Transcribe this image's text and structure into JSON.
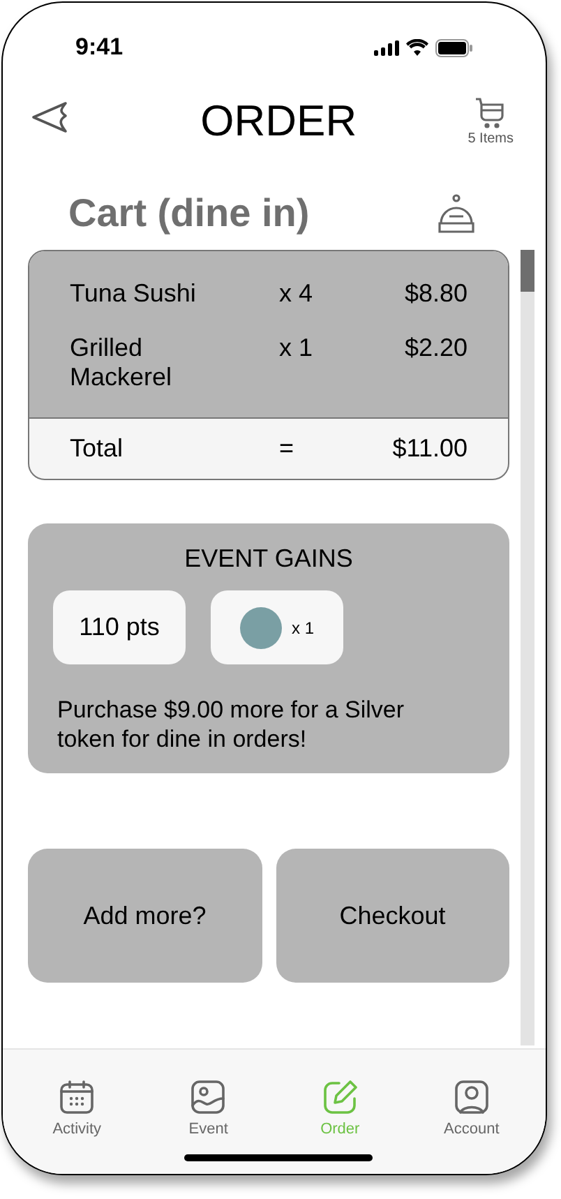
{
  "status_bar": {
    "time": "9:41"
  },
  "header": {
    "title": "ORDER",
    "cart_count": "5 Items"
  },
  "cart": {
    "title": "Cart (dine in)",
    "items": [
      {
        "name": "Tuna Sushi",
        "qty": "x 4",
        "price": "$8.80"
      },
      {
        "name": "Grilled Mackerel",
        "qty": "x 1",
        "price": "$2.20"
      }
    ],
    "total": {
      "label": "Total",
      "sign": "=",
      "amount": "$11.00"
    }
  },
  "event_gains": {
    "title": "EVENT GAINS",
    "points": "110 pts",
    "token": {
      "color": "#7a9fa4",
      "count": "x 1"
    },
    "message": "Purchase $9.00 more for a Silver token for dine in orders!"
  },
  "buttons": [
    "Add more?",
    "Checkout"
  ],
  "tabs": [
    {
      "label": "Activity",
      "selected": false
    },
    {
      "label": "Event",
      "selected": false
    },
    {
      "label": "Order",
      "selected": true
    },
    {
      "label": "Account",
      "selected": false
    }
  ]
}
